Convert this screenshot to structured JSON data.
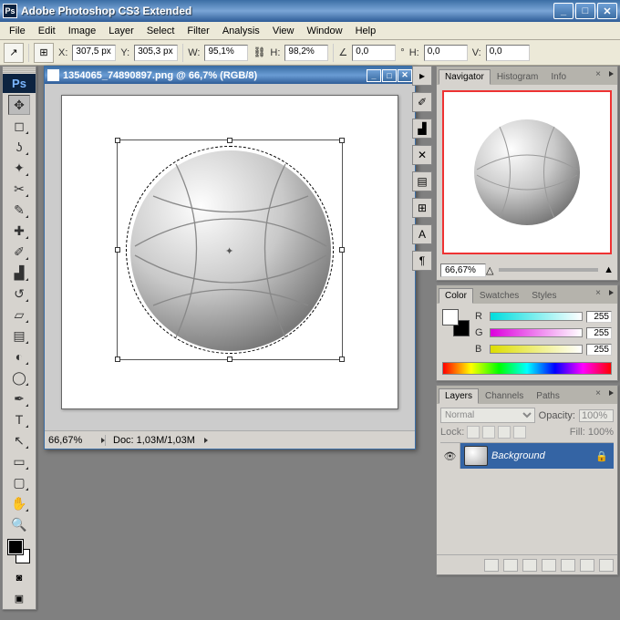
{
  "app": {
    "title": "Adobe Photoshop CS3 Extended",
    "logo": "Ps"
  },
  "menu": [
    "File",
    "Edit",
    "Image",
    "Layer",
    "Select",
    "Filter",
    "Analysis",
    "View",
    "Window",
    "Help"
  ],
  "options": {
    "x_label": "X:",
    "x": "307,5 px",
    "y_label": "Y:",
    "y": "305,3 px",
    "w_label": "W:",
    "w": "95,1%",
    "h_label": "H:",
    "h": "98,2%",
    "a_label": "∠",
    "a": "0,0",
    "a_unit": "°",
    "hskew_label": "H:",
    "hskew": "0,0",
    "vskew_label": "V:",
    "vskew": "0,0"
  },
  "doc": {
    "title": "1354065_74890897.png @ 66,7% (RGB/8)",
    "zoom": "66,67%",
    "info": "Doc: 1,03M/1,03M"
  },
  "panels": {
    "nav": {
      "tabs": [
        "Navigator",
        "Histogram",
        "Info"
      ],
      "zoom": "66,67%"
    },
    "color": {
      "tabs": [
        "Color",
        "Swatches",
        "Styles"
      ],
      "r_label": "R",
      "r": "255",
      "g_label": "G",
      "g": "255",
      "b_label": "B",
      "b": "255"
    },
    "layers": {
      "tabs": [
        "Layers",
        "Channels",
        "Paths"
      ],
      "blend": "Normal",
      "opacity_label": "Opacity:",
      "opacity": "100%",
      "lock_label": "Lock:",
      "fill_label": "Fill:",
      "fill": "100%",
      "layer_name": "Background"
    }
  }
}
